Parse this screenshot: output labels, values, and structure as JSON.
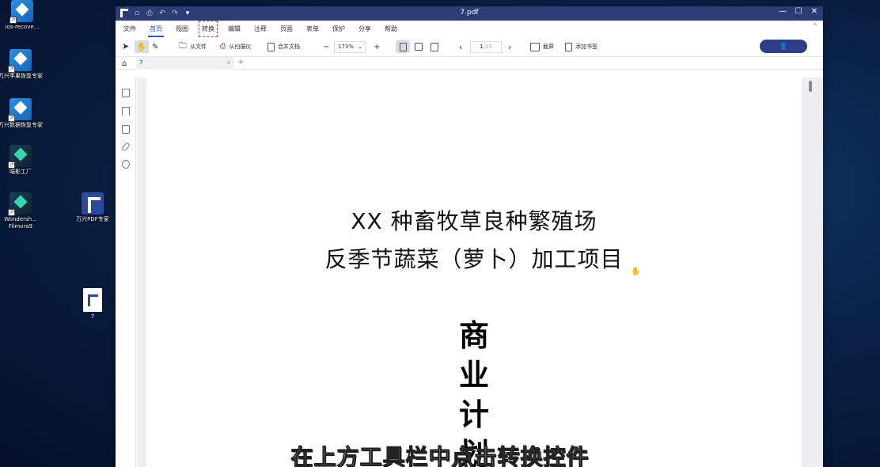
{
  "desktop": {
    "icons": [
      {
        "label": "ios-recove..."
      },
      {
        "label": "万兴苹果恢复专家"
      },
      {
        "label": "万兴数据恢复专家"
      },
      {
        "label": "喵影工厂"
      },
      {
        "label": "Wondersh... Filmora9"
      },
      {
        "label": "万兴PDF专家"
      },
      {
        "label": "7"
      }
    ]
  },
  "window": {
    "title": "7.pdf",
    "controls": {
      "minimize": "—",
      "maximize": "☐",
      "close": "✕"
    }
  },
  "menu": {
    "items": [
      {
        "label": "文件"
      },
      {
        "label": "首页"
      },
      {
        "label": "视图"
      },
      {
        "label": "转换"
      },
      {
        "label": "编辑"
      },
      {
        "label": "注释"
      },
      {
        "label": "页面"
      },
      {
        "label": "表单"
      },
      {
        "label": "保护"
      },
      {
        "label": "分享"
      },
      {
        "label": "帮助"
      }
    ],
    "active": "首页",
    "highlighted": "转换"
  },
  "toolbar": {
    "from_file": "从文件",
    "from_scanner": "从扫描仪",
    "merge": "合并文档",
    "zoom_minus": "−",
    "zoom_value": "173%",
    "zoom_plus": "+",
    "page_prev": "‹",
    "page_current": "1",
    "page_total": "/15",
    "page_next": "›",
    "screenshot": "截屏",
    "add_bookmark": "添加书签",
    "login_icon": "👤"
  },
  "tabs": {
    "doc_tab": "7",
    "close": "×",
    "add": "+"
  },
  "document": {
    "line1": "XX 种畜牧草良种繁殖场",
    "line2": "反季节蔬菜（萝卜）加工项目",
    "vertical": [
      "商",
      "业",
      "计",
      "划"
    ]
  },
  "overlay": {
    "subtitle": "在上方工具栏中点击转换控件"
  },
  "colors": {
    "titlebar": "#2b3d74",
    "accent": "#2b5cc9",
    "login_button": "#2e3f88"
  }
}
